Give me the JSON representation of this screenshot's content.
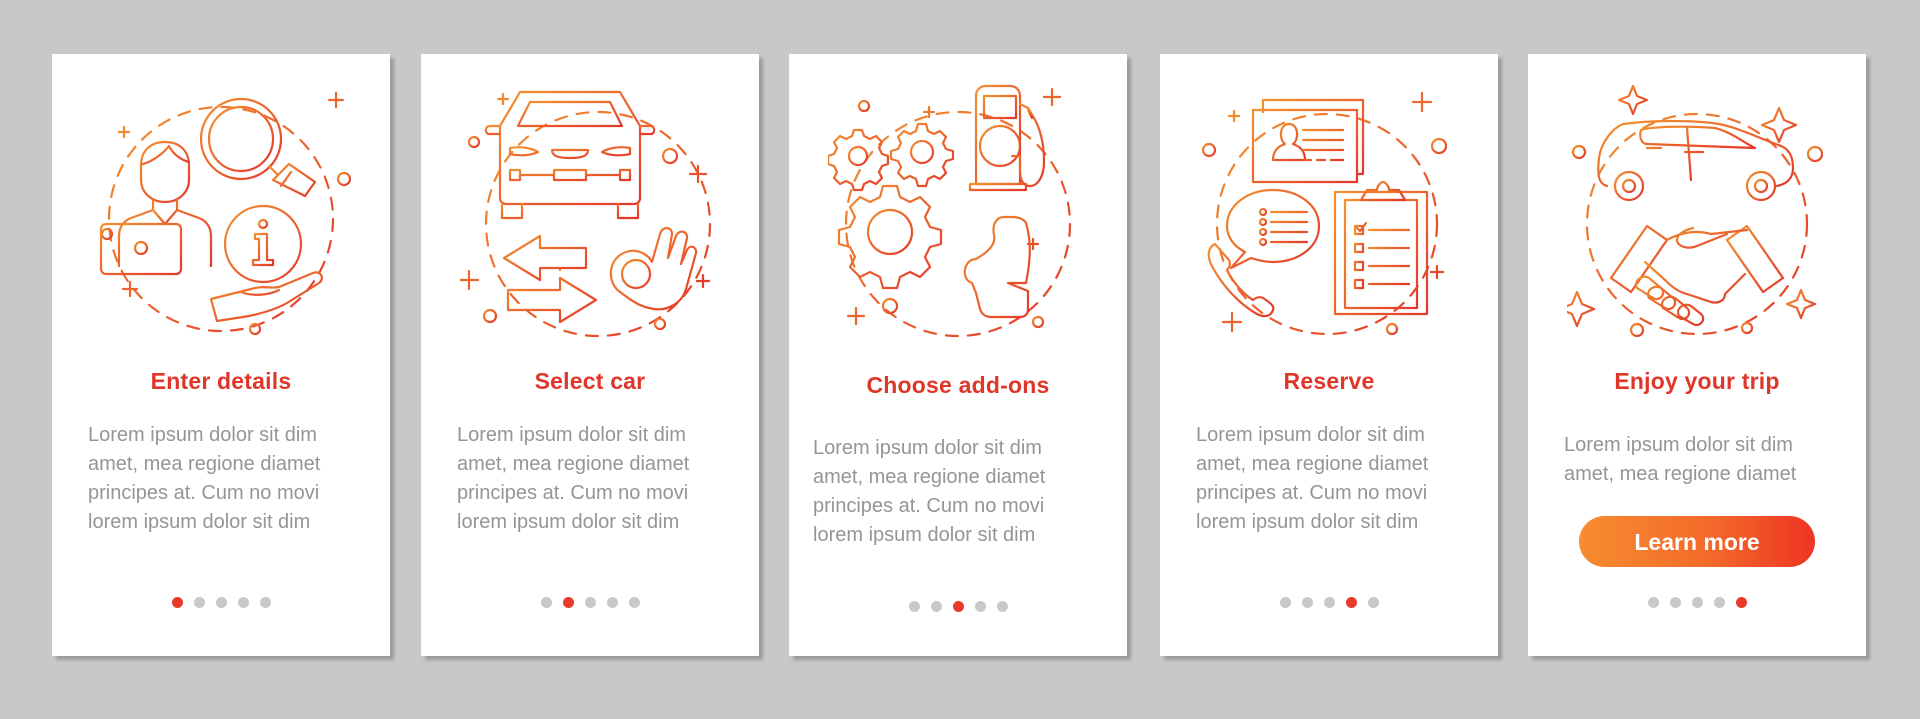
{
  "theme": {
    "background": "#c8c8c8",
    "title_color": "#e0362a",
    "body_color": "#959595",
    "dot_active": "#e8392a",
    "dot_inactive": "#c9c9c9",
    "icon_gradient": [
      "#f08a33",
      "#e5392b"
    ],
    "button_gradient": [
      "#f78c30",
      "#ee3424"
    ]
  },
  "cards": [
    {
      "title": "Enter details",
      "illustration": "user-laptop-search-info-icon",
      "body_lines": [
        "Lorem ipsum dolor sit dim",
        "amet, mea regione diamet",
        "principes at. Cum no movi",
        "lorem ipsum dolor sit dim"
      ],
      "active_step": 1
    },
    {
      "title": "Select car",
      "illustration": "car-arrows-ok-hand-icon",
      "body_lines": [
        "Lorem ipsum dolor sit dim",
        "amet, mea regione diamet",
        "principes at. Cum no movi",
        "lorem ipsum dolor sit dim"
      ],
      "active_step": 2
    },
    {
      "title": "Choose add-ons",
      "illustration": "gears-fuel-pump-car-seat-icon",
      "body_lines": [
        "Lorem ipsum dolor sit dim",
        "amet, mea regione diamet",
        "principes at. Cum no movi",
        "lorem ipsum dolor sit dim"
      ],
      "active_step": 3
    },
    {
      "title": "Reserve",
      "illustration": "id-card-phone-chat-clipboard-icon",
      "body_lines": [
        "Lorem ipsum dolor sit dim",
        "amet, mea regione diamet",
        "principes at. Cum no movi",
        "lorem ipsum dolor sit dim"
      ],
      "active_step": 4
    },
    {
      "title": "Enjoy your trip",
      "illustration": "car-handshake-sparkles-icon",
      "body_lines": [
        "Lorem ipsum dolor sit dim",
        "amet, mea regione diamet"
      ],
      "button_label": "Learn more",
      "active_step": 5
    }
  ],
  "pagination": {
    "total_steps": 5
  }
}
